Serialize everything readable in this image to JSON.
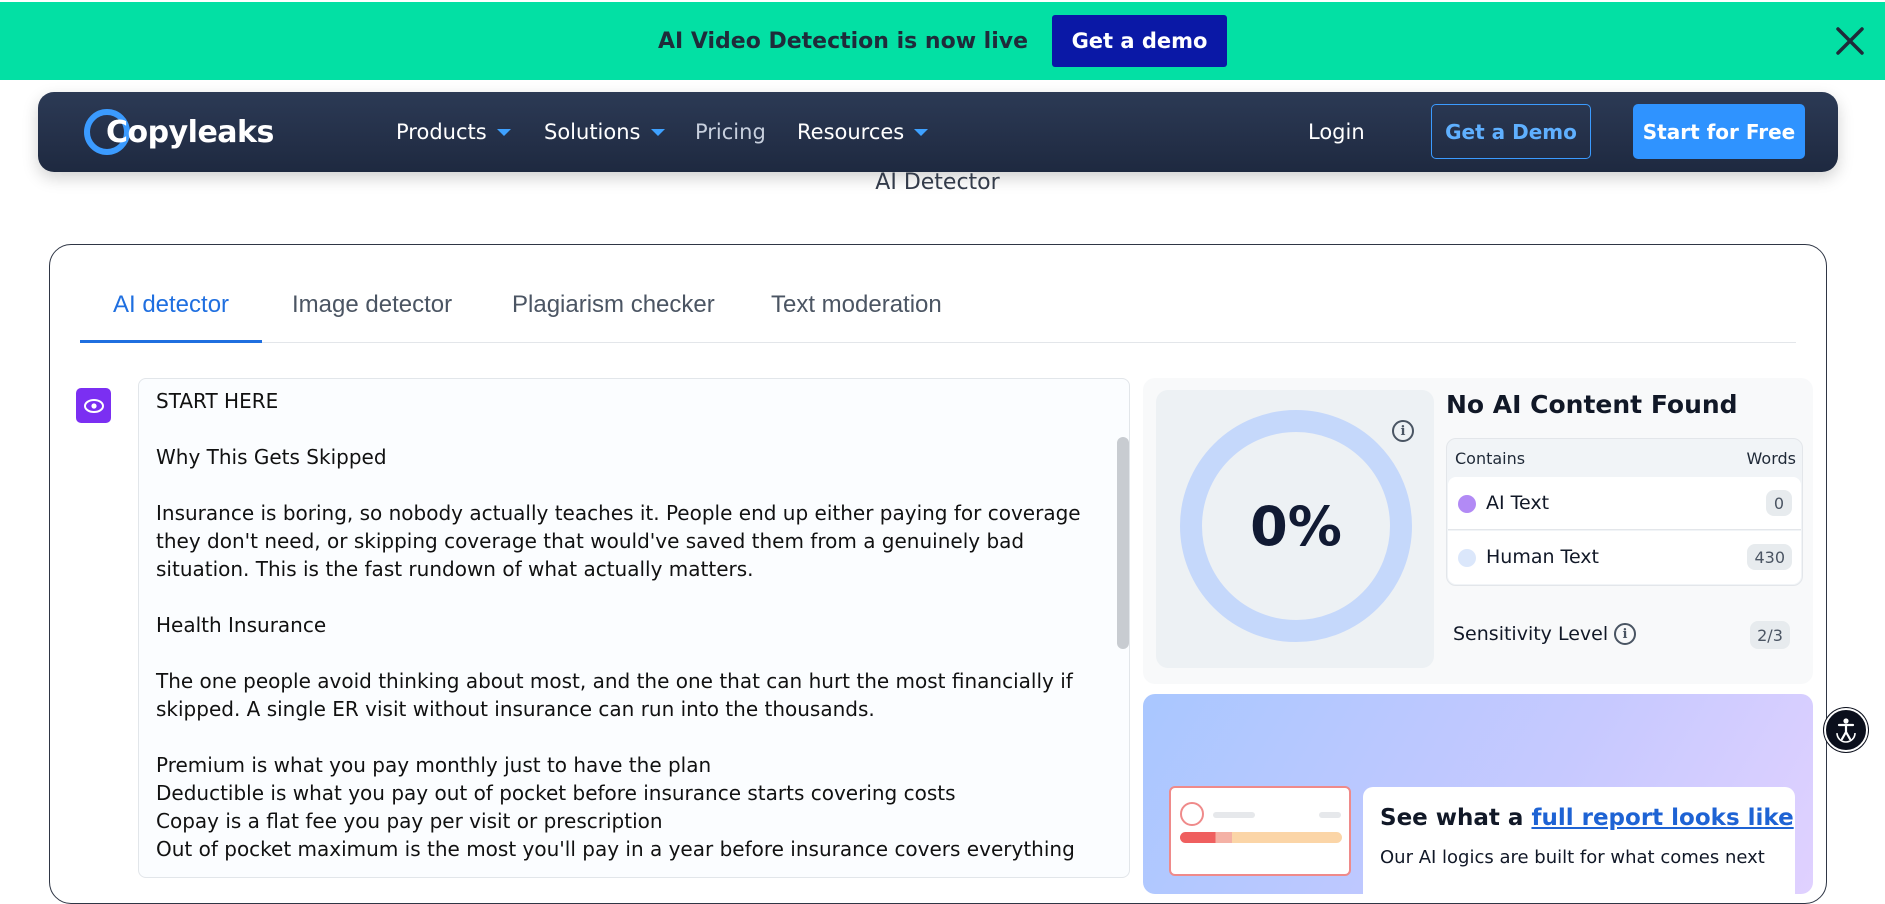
{
  "banner": {
    "text": "AI Video Detection is now live",
    "button": "Get a demo",
    "close_icon": "close-icon",
    "bg_color": "#03e0a4",
    "button_color": "#0a18a6"
  },
  "nav": {
    "logo": "Copyleaks",
    "items": [
      {
        "label": "Products",
        "has_dropdown": true
      },
      {
        "label": "Solutions",
        "has_dropdown": true
      },
      {
        "label": "Pricing",
        "has_dropdown": false
      },
      {
        "label": "Resources",
        "has_dropdown": true
      }
    ],
    "login": "Login",
    "demo": "Get a Demo",
    "start": "Start for Free",
    "accent_color": "#2f93ff"
  },
  "page": {
    "subtitle": "AI Detector"
  },
  "tabs": [
    {
      "label": "AI detector",
      "active": true
    },
    {
      "label": "Image detector",
      "active": false
    },
    {
      "label": "Plagiarism checker",
      "active": false
    },
    {
      "label": "Text moderation",
      "active": false
    }
  ],
  "editor": {
    "side_icon": "eye-icon",
    "lines": [
      "START HERE",
      "",
      "Why This Gets Skipped",
      "",
      "Insurance is boring, so nobody actually teaches it. People end up either paying for coverage",
      "they don't need, or skipping coverage that would've saved them from a genuinely bad",
      "situation. This is the fast rundown of what actually matters.",
      "",
      "Health Insurance",
      "",
      "The one people avoid thinking about most, and the one that can hurt the most financially if",
      "skipped. A single ER visit without insurance can run into the thousands.",
      "",
      "Premium is what you pay monthly just to have the plan",
      "Deductible is what you pay out of pocket before insurance starts covering costs",
      "Copay is a flat fee you pay per visit or prescription",
      "Out of pocket maximum is the most you'll pay in a year before insurance covers everything"
    ]
  },
  "result": {
    "percent": "0%",
    "title": "No AI Content Found",
    "table_header": {
      "contains": "Contains",
      "words": "Words"
    },
    "rows": [
      {
        "label": "AI Text",
        "count": "0",
        "dot_color": "#b28af5"
      },
      {
        "label": "Human Text",
        "count": "430",
        "dot_color": "#dbe7fb"
      }
    ],
    "sensitivity_label": "Sensitivity Level",
    "sensitivity_value": "2/3"
  },
  "promo": {
    "title_prefix": "See what a ",
    "title_link": "full report looks like",
    "subtitle": "Our AI logics are built for what comes next"
  },
  "accessibility_icon": "accessibility-icon"
}
